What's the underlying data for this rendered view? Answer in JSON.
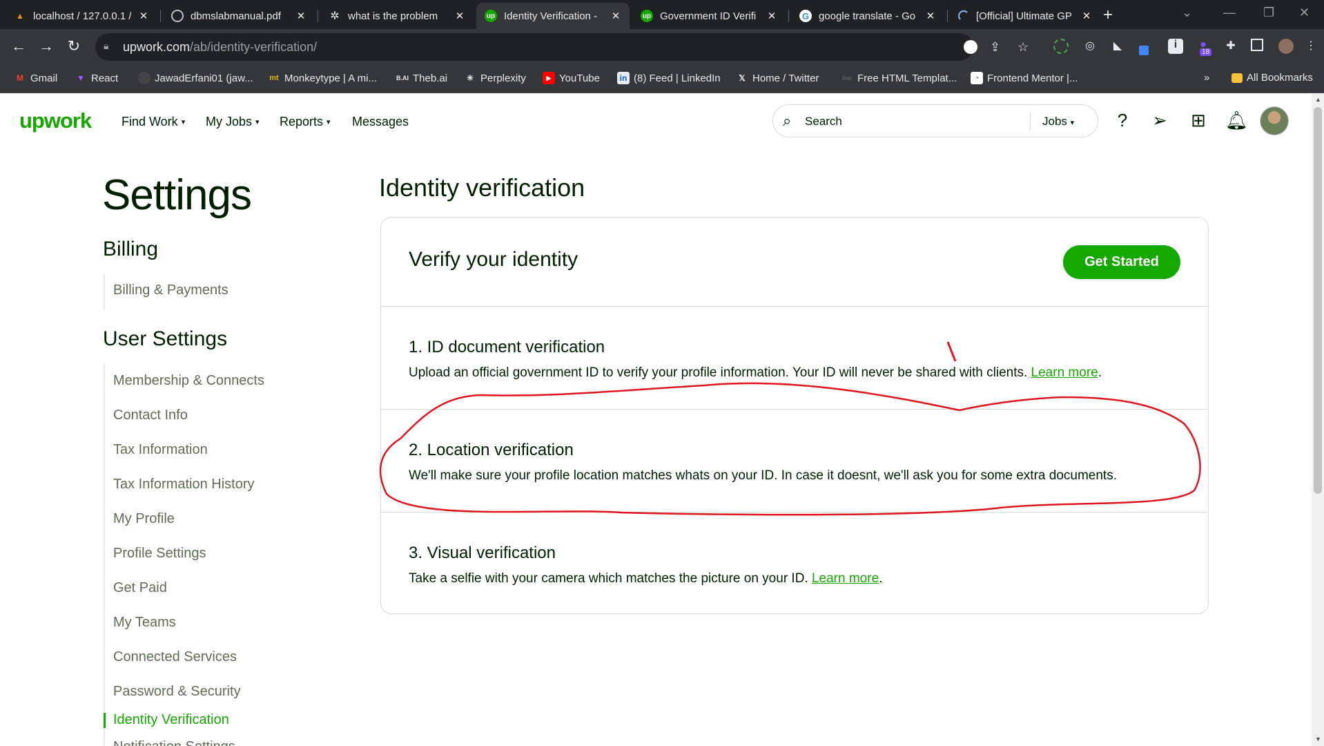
{
  "browser": {
    "tabs": [
      {
        "title": "localhost / 127.0.0.1 /",
        "favicon": "phpmyadmin-icon"
      },
      {
        "title": "dbmslabmanual.pdf",
        "favicon": "globe-icon"
      },
      {
        "title": "what is the problem",
        "favicon": "openai-icon"
      },
      {
        "title": "Identity Verification -",
        "favicon": "upwork-icon"
      },
      {
        "title": "Government ID Verifi",
        "favicon": "upwork-icon"
      },
      {
        "title": "google translate - Go",
        "favicon": "google-icon"
      },
      {
        "title": "[Official] Ultimate GP",
        "favicon": "loading-icon"
      }
    ],
    "close_glyph": "✕",
    "new_tab_glyph": "+",
    "url_host": "upwork.com",
    "url_path": "/ab/identity-verification/",
    "extension_badge": "18",
    "bookmarks": [
      {
        "label": "Gmail",
        "icon": "gmail-icon"
      },
      {
        "label": "React",
        "icon": "vite-icon"
      },
      {
        "label": "JawadErfani01 (jaw...",
        "icon": "github-icon"
      },
      {
        "label": "Monkeytype | A mi...",
        "icon": "monkeytype-icon"
      },
      {
        "label": "Theb.ai",
        "icon": "thebai-icon"
      },
      {
        "label": "Perplexity",
        "icon": "perplexity-icon"
      },
      {
        "label": "YouTube",
        "icon": "youtube-icon"
      },
      {
        "label": "(8) Feed | LinkedIn",
        "icon": "linkedin-icon"
      },
      {
        "label": "Home / Twitter",
        "icon": "x-icon"
      },
      {
        "label": "Free HTML Templat...",
        "icon": "template-icon"
      },
      {
        "label": "Frontend Mentor |...",
        "icon": "frontendmentor-icon"
      }
    ],
    "bookmarks_overflow": "»",
    "all_bookmarks": "All Bookmarks"
  },
  "header": {
    "logo": "upwork",
    "nav": [
      {
        "label": "Find Work",
        "dropdown": true
      },
      {
        "label": "My Jobs",
        "dropdown": true
      },
      {
        "label": "Reports",
        "dropdown": true
      },
      {
        "label": "Messages",
        "dropdown": false
      }
    ],
    "search_placeholder": "Search",
    "search_scope": "Jobs"
  },
  "sidebar": {
    "title": "Settings",
    "billing_heading": "Billing",
    "billing_items": [
      "Billing & Payments"
    ],
    "user_heading": "User Settings",
    "user_items": [
      "Membership & Connects",
      "Contact Info",
      "Tax Information",
      "Tax Information History",
      "My Profile",
      "Profile Settings",
      "Get Paid",
      "My Teams",
      "Connected Services",
      "Password & Security",
      "Identity Verification",
      "Notification Settings"
    ],
    "active_item": "Identity Verification"
  },
  "main": {
    "title": "Identity verification",
    "card_title": "Verify your identity",
    "get_started": "Get Started",
    "steps": [
      {
        "title": "1. ID document verification",
        "desc": "Upload an official government ID to verify your profile information. Your ID will never be shared with clients.",
        "link": "Learn more",
        "suffix": "."
      },
      {
        "title": "2. Location verification",
        "desc": "We'll make sure your profile location matches whats on your ID. In case it doesnt, we'll ask you for some extra documents.",
        "link": "",
        "suffix": ""
      },
      {
        "title": "3. Visual verification",
        "desc": "Take a selfie with your camera which matches the picture on your ID.",
        "link": "Learn more",
        "suffix": "."
      }
    ]
  },
  "colors": {
    "brand_green": "#14a800",
    "annotation_red": "#e0141e",
    "chrome_dark": "#202124",
    "chrome_toolbar": "#35363a"
  }
}
